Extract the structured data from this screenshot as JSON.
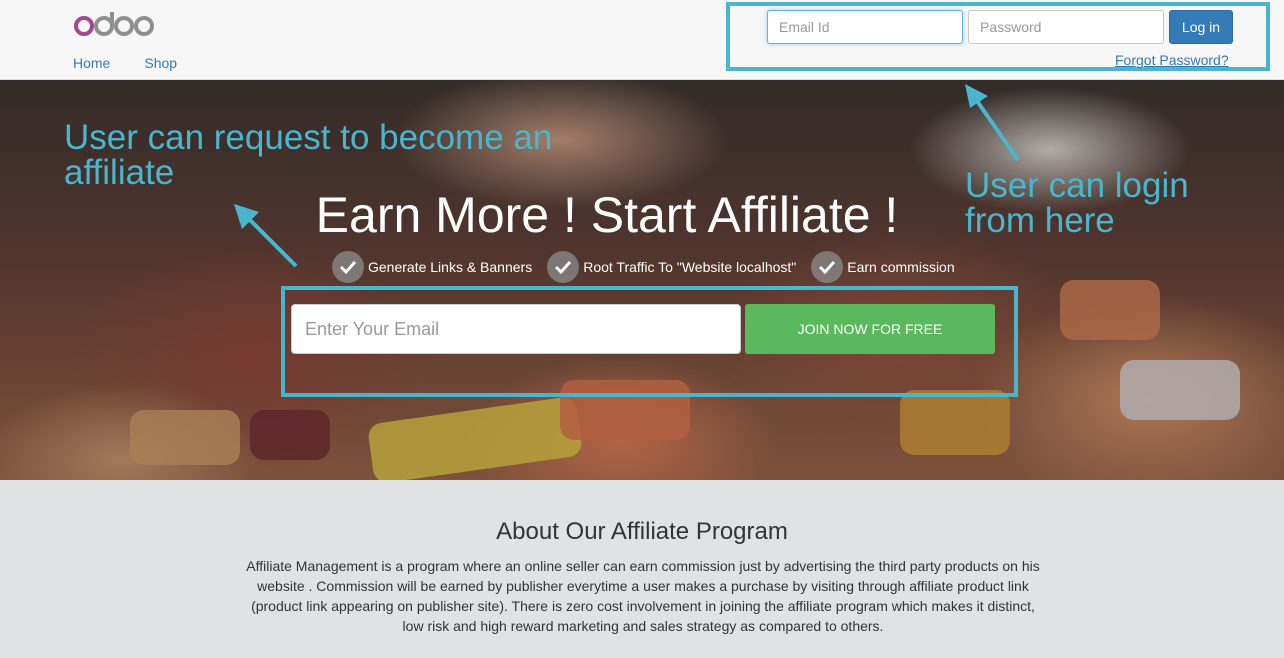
{
  "header": {
    "logo_text": "odoo",
    "nav": [
      "Home",
      "Shop"
    ],
    "login": {
      "email_placeholder": "Email Id",
      "password_placeholder": "Password",
      "login_label": "Log in",
      "forgot_label": "Forgot Password?"
    }
  },
  "annotations": {
    "left": "User can request to become an affiliate",
    "right": "User can login from here"
  },
  "hero": {
    "title": "Earn More ! Start Affiliate !",
    "features": [
      "Generate Links & Banners",
      "Root Traffic To \"Website localhost\"",
      "Earn commission"
    ],
    "email_placeholder": "Enter Your Email",
    "join_label": "JOIN NOW FOR FREE"
  },
  "about": {
    "title": "About Our Affiliate Program",
    "text": "Affiliate Management is a program where an online seller can earn commission just by advertising the third party products on his website . Commission will be earned by publisher everytime a user makes a purchase by visiting through affiliate product link (product link appearing on publisher site). There is zero cost involvement in joining the affiliate program which makes it distinct, low risk and high reward marketing and sales strategy as compared to others."
  },
  "colors": {
    "annotation": "#4ab6ce",
    "link": "#337ab7",
    "join_button": "#5cb85c",
    "login_button": "#337ab7"
  }
}
